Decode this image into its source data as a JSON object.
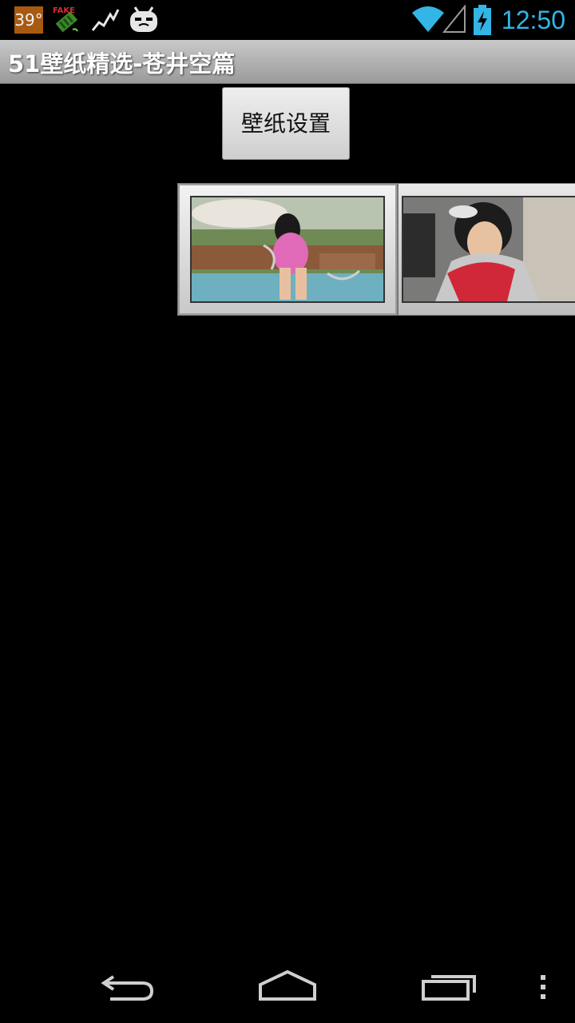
{
  "status_bar": {
    "temperature": "39°",
    "clock": "12:50",
    "icons": [
      "temperature-badge",
      "fake-gps-icon",
      "activity-graph-icon",
      "cyanogen-mascot-icon",
      "wifi-icon",
      "signal-icon",
      "battery-charging-icon"
    ],
    "accent_color": "#33b5e5"
  },
  "app": {
    "title": "51壁纸精选-苍井空篇"
  },
  "main": {
    "set_wallpaper_label": "壁纸设置",
    "gallery": {
      "items": [
        {
          "name": "gallery-thumbnail-1",
          "selected": true
        },
        {
          "name": "gallery-thumbnail-2",
          "selected": false
        }
      ]
    }
  },
  "nav_bar": {
    "buttons": [
      "back-icon",
      "home-icon",
      "recent-apps-icon",
      "overflow-menu-icon"
    ]
  }
}
